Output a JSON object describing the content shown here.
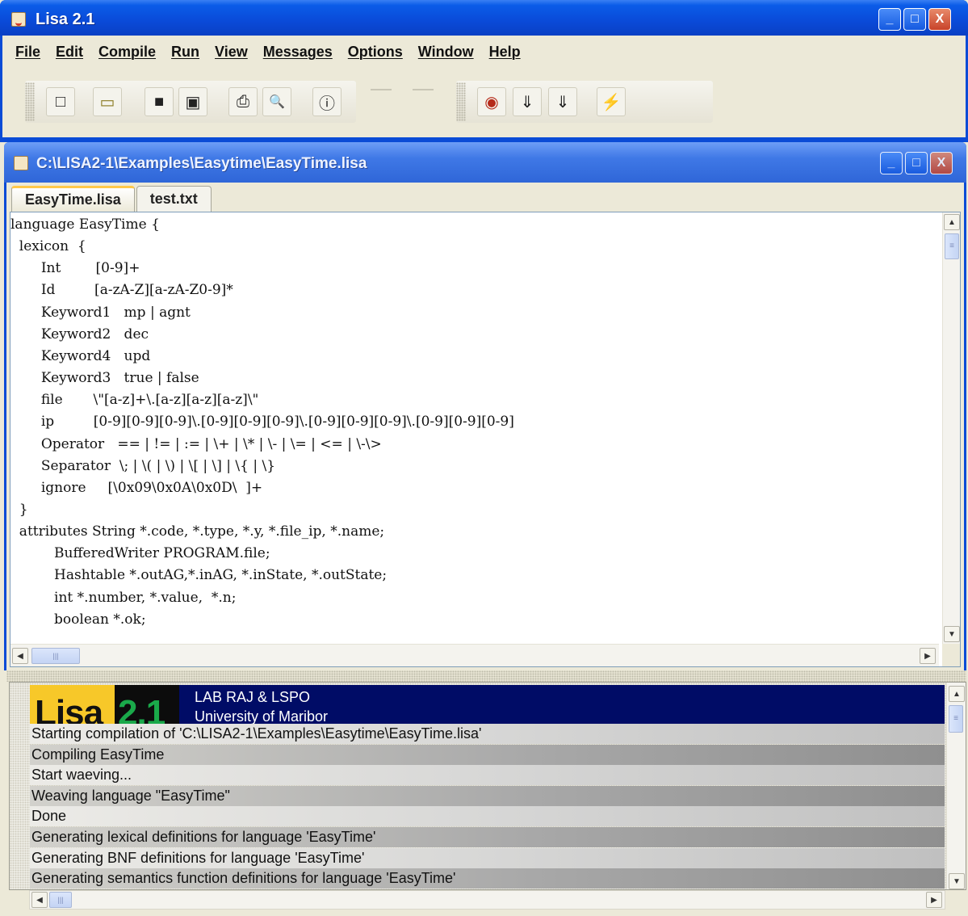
{
  "app": {
    "title": "Lisa 2.1",
    "menu": [
      "File",
      "Edit",
      "Compile",
      "Run",
      "View",
      "Messages",
      "Options",
      "Window",
      "Help"
    ],
    "window_buttons": {
      "minimize": "_",
      "maximize": "□",
      "close": "X"
    }
  },
  "toolbar": {
    "icons": {
      "new": "□",
      "open": "▭",
      "save": "■",
      "save_all": "▣",
      "print": "⎙",
      "print_preview": "🔍",
      "about": "ⓘ",
      "find": "◉",
      "compile": "⇓",
      "build": "⇓",
      "run": "⚡"
    }
  },
  "document": {
    "title": "C:\\LISA2-1\\Examples\\Easytime\\EasyTime.lisa",
    "tabs": [
      "EasyTime.lisa",
      "test.txt"
    ],
    "active_tab": 0,
    "code_lines": [
      "language EasyTime {",
      "  lexicon  {",
      "       Int        [0-9]+",
      "       Id         [a-zA-Z][a-zA-Z0-9]*",
      "       Keyword1   mp | agnt",
      "       Keyword2   dec",
      "       Keyword4   upd",
      "       Keyword3   true | false",
      "       file       \\\"[a-z]+\\.[a-z][a-z][a-z]\\\"",
      "       ip         [0-9][0-9][0-9]\\.[0-9][0-9][0-9]\\.[0-9][0-9][0-9]\\.[0-9][0-9][0-9]",
      "       Operator   == | != | := | \\+ | \\* | \\- | \\= | <= | \\-\\>",
      "       Separator  \\; | \\( | \\) | \\[ | \\] | \\{ | \\}",
      "       ignore     [\\0x09\\0x0A\\0x0D\\  ]+",
      "  }",
      "  attributes String *.code, *.type, *.y, *.file_ip, *.name;",
      "          BufferedWriter PROGRAM.file;",
      "          Hashtable *.outAG,*.inAG, *.inState, *.outState;",
      "          int *.number, *.value,  *.n;",
      "          boolean *.ok;"
    ]
  },
  "messages": {
    "logo": {
      "name": "Lisa",
      "version": "2.1"
    },
    "banner_line1": "LAB RAJ & LSPO",
    "banner_line2": "University of Maribor",
    "lines": [
      "Starting compilation of 'C:\\LISA2-1\\Examples\\Easytime\\EasyTime.lisa'",
      "Compiling EasyTime",
      "Start waeving...",
      "Weaving language \"EasyTime\"",
      "Done",
      "Generating lexical definitions for language 'EasyTime'",
      "Generating BNF definitions for language 'EasyTime'",
      "Generating semantics function definitions for language 'EasyTime'"
    ]
  },
  "scroll": {
    "up": "▲",
    "down": "▼",
    "left": "◀",
    "right": "▶",
    "grip": "≡",
    "hgrip": "|||"
  }
}
